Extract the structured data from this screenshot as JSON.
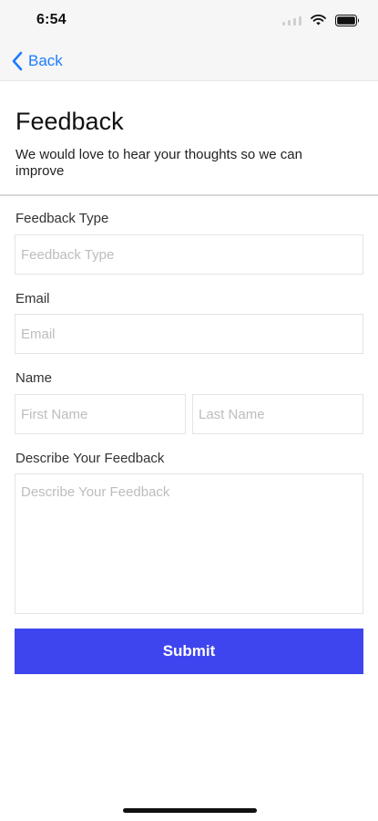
{
  "status_bar": {
    "time": "6:54",
    "icons": [
      "signal-icon",
      "wifi-icon",
      "battery-icon"
    ]
  },
  "nav": {
    "back_label": "Back",
    "back_icon": "chevron-left-icon"
  },
  "header": {
    "title": "Feedback",
    "subtitle": "We would love to hear your thoughts so we can improve"
  },
  "form": {
    "feedback_type": {
      "label": "Feedback Type",
      "value": "",
      "placeholder": "Feedback Type"
    },
    "email": {
      "label": "Email",
      "value": "",
      "placeholder": "Email"
    },
    "name": {
      "label": "Name",
      "first_name": {
        "value": "",
        "placeholder": "First Name"
      },
      "last_name": {
        "value": "",
        "placeholder": "Last Name"
      }
    },
    "description": {
      "label": "Describe Your Feedback",
      "value": "",
      "placeholder": "Describe Your Feedback"
    },
    "submit_label": "Submit"
  },
  "colors": {
    "accent": "#3f45ee",
    "link": "#1e7cff",
    "topbar_bg": "#f6f6f6",
    "field_border": "#e4e4e4",
    "placeholder": "#bdbdbd"
  }
}
